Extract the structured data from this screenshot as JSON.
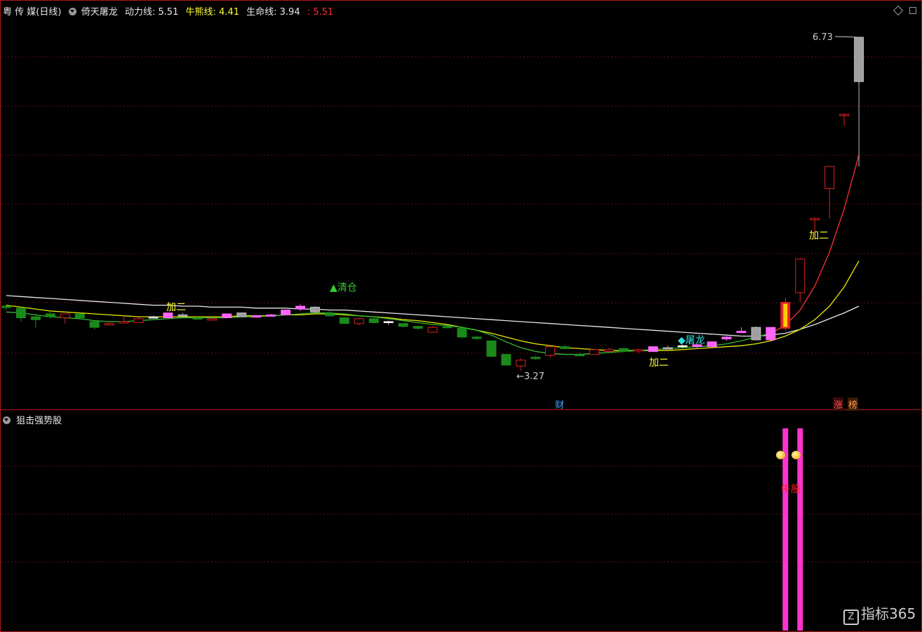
{
  "header": {
    "stock_name": "粤 传 媒(日线)",
    "indicator_name": "倚天屠龙",
    "power_label": "动力线:",
    "power_value": "5.51",
    "bull_label": "牛熊线:",
    "bull_value": "4.41",
    "life_label": "生命线:",
    "life_value": "3.94",
    "extra_value": ": 5.51"
  },
  "main_panel": {
    "price_high_label": "6.73",
    "price_low_label": "←3.27",
    "signals": [
      "清仓",
      "加二",
      "屠龙",
      "加二",
      "加二"
    ],
    "bottom_badges": [
      "财",
      "涨",
      "榜"
    ]
  },
  "sub_panel": {
    "title": "狙击强势股",
    "signal_text": "牛股"
  },
  "watermark": "指标365",
  "colors": {
    "background": "#000000",
    "border": "#b01818",
    "grid": "#5a1010",
    "up": "#e02020",
    "down": "#1a8a1a",
    "magenta": "#ff66ff",
    "gray": "#a0a0a0",
    "white_line": "#e8e8e8",
    "yellow_line": "#e8e800",
    "green_line": "#33bb33",
    "red_line": "#ff3030",
    "bar_magenta": "#ff33cc",
    "signal_yellow": "#ffff33",
    "signal_cyan": "#33dddd",
    "signal_green": "#33cc33"
  },
  "chart_data": {
    "type": "candlestick",
    "candles": [
      {
        "o": 3.94,
        "h": 3.96,
        "l": 3.9,
        "c": 3.93,
        "k": "down"
      },
      {
        "o": 3.92,
        "h": 3.93,
        "l": 3.78,
        "c": 3.82,
        "k": "down"
      },
      {
        "o": 3.83,
        "h": 3.86,
        "l": 3.72,
        "c": 3.8,
        "k": "down"
      },
      {
        "o": 3.83,
        "h": 3.88,
        "l": 3.81,
        "c": 3.86,
        "k": "down"
      },
      {
        "o": 3.82,
        "h": 3.86,
        "l": 3.76,
        "c": 3.86,
        "k": "up"
      },
      {
        "o": 3.86,
        "h": 3.87,
        "l": 3.8,
        "c": 3.82,
        "k": "down"
      },
      {
        "o": 3.78,
        "h": 3.79,
        "l": 3.7,
        "c": 3.72,
        "k": "down"
      },
      {
        "o": 3.76,
        "h": 3.77,
        "l": 3.74,
        "c": 3.76,
        "k": "up"
      },
      {
        "o": 3.77,
        "h": 3.85,
        "l": 3.76,
        "c": 3.78,
        "k": "up"
      },
      {
        "o": 3.77,
        "h": 3.82,
        "l": 3.77,
        "c": 3.81,
        "k": "up"
      },
      {
        "o": 3.83,
        "h": 3.84,
        "l": 3.82,
        "c": 3.83,
        "k": "flat"
      },
      {
        "o": 3.82,
        "h": 3.87,
        "l": 3.81,
        "c": 3.87,
        "k": "mag"
      },
      {
        "o": 3.85,
        "h": 3.87,
        "l": 3.83,
        "c": 3.85,
        "k": "gray"
      },
      {
        "o": 3.82,
        "h": 3.84,
        "l": 3.8,
        "c": 3.81,
        "k": "down"
      },
      {
        "o": 3.81,
        "h": 3.82,
        "l": 3.8,
        "c": 3.81,
        "k": "up"
      },
      {
        "o": 3.82,
        "h": 3.86,
        "l": 3.82,
        "c": 3.86,
        "k": "mag"
      },
      {
        "o": 3.83,
        "h": 3.87,
        "l": 3.83,
        "c": 3.87,
        "k": "gray"
      },
      {
        "o": 3.84,
        "h": 3.85,
        "l": 3.83,
        "c": 3.84,
        "k": "mag"
      },
      {
        "o": 3.84,
        "h": 3.86,
        "l": 3.83,
        "c": 3.85,
        "k": "mag"
      },
      {
        "o": 3.85,
        "h": 3.9,
        "l": 3.85,
        "c": 3.9,
        "k": "mag"
      },
      {
        "o": 3.91,
        "h": 3.96,
        "l": 3.89,
        "c": 3.94,
        "k": "mag"
      },
      {
        "o": 3.93,
        "h": 3.94,
        "l": 3.87,
        "c": 3.88,
        "k": "gray"
      },
      {
        "o": 3.86,
        "h": 3.89,
        "l": 3.83,
        "c": 3.84,
        "k": "down"
      },
      {
        "o": 3.82,
        "h": 3.82,
        "l": 3.76,
        "c": 3.76,
        "k": "down"
      },
      {
        "o": 3.76,
        "h": 3.82,
        "l": 3.74,
        "c": 3.81,
        "k": "up"
      },
      {
        "o": 3.81,
        "h": 3.82,
        "l": 3.76,
        "c": 3.77,
        "k": "down"
      },
      {
        "o": 3.77,
        "h": 3.79,
        "l": 3.75,
        "c": 3.78,
        "k": "cross"
      },
      {
        "o": 3.76,
        "h": 3.76,
        "l": 3.72,
        "c": 3.73,
        "k": "down"
      },
      {
        "o": 3.73,
        "h": 3.74,
        "l": 3.7,
        "c": 3.71,
        "k": "down"
      },
      {
        "o": 3.67,
        "h": 3.73,
        "l": 3.67,
        "c": 3.72,
        "k": "up"
      },
      {
        "o": 3.73,
        "h": 3.74,
        "l": 3.72,
        "c": 3.73,
        "k": "down"
      },
      {
        "o": 3.71,
        "h": 3.71,
        "l": 3.61,
        "c": 3.62,
        "k": "down"
      },
      {
        "o": 3.62,
        "h": 3.63,
        "l": 3.59,
        "c": 3.61,
        "k": "down"
      },
      {
        "o": 3.58,
        "h": 3.58,
        "l": 3.41,
        "c": 3.42,
        "k": "down"
      },
      {
        "o": 3.44,
        "h": 3.44,
        "l": 3.32,
        "c": 3.33,
        "k": "down"
      },
      {
        "o": 3.32,
        "h": 3.4,
        "l": 3.27,
        "c": 3.38,
        "k": "up"
      },
      {
        "o": 3.4,
        "h": 3.43,
        "l": 3.38,
        "c": 3.41,
        "k": "down"
      },
      {
        "o": 3.43,
        "h": 3.53,
        "l": 3.41,
        "c": 3.52,
        "k": "up"
      },
      {
        "o": 3.52,
        "h": 3.54,
        "l": 3.49,
        "c": 3.5,
        "k": "down"
      },
      {
        "o": 3.44,
        "h": 3.46,
        "l": 3.43,
        "c": 3.44,
        "k": "down"
      },
      {
        "o": 3.44,
        "h": 3.49,
        "l": 3.44,
        "c": 3.49,
        "k": "up"
      },
      {
        "o": 3.47,
        "h": 3.51,
        "l": 3.46,
        "c": 3.49,
        "k": "up"
      },
      {
        "o": 3.5,
        "h": 3.51,
        "l": 3.46,
        "c": 3.47,
        "k": "down"
      },
      {
        "o": 3.49,
        "h": 3.5,
        "l": 3.45,
        "c": 3.48,
        "k": "up"
      },
      {
        "o": 3.47,
        "h": 3.52,
        "l": 3.47,
        "c": 3.52,
        "k": "mag"
      },
      {
        "o": 3.51,
        "h": 3.53,
        "l": 3.5,
        "c": 3.51,
        "k": "gray"
      },
      {
        "o": 3.52,
        "h": 3.54,
        "l": 3.51,
        "c": 3.53,
        "k": "cross"
      },
      {
        "o": 3.52,
        "h": 3.55,
        "l": 3.51,
        "c": 3.54,
        "k": "mag"
      },
      {
        "o": 3.52,
        "h": 3.57,
        "l": 3.52,
        "c": 3.57,
        "k": "mag"
      },
      {
        "o": 3.6,
        "h": 3.63,
        "l": 3.58,
        "c": 3.62,
        "k": "mag"
      },
      {
        "o": 3.67,
        "h": 3.72,
        "l": 3.67,
        "c": 3.68,
        "k": "mag"
      },
      {
        "o": 3.59,
        "h": 3.73,
        "l": 3.59,
        "c": 3.72,
        "k": "gray"
      },
      {
        "o": 3.59,
        "h": 3.72,
        "l": 3.59,
        "c": 3.72,
        "k": "mag"
      },
      {
        "o": 3.71,
        "h": 4.03,
        "l": 3.68,
        "c": 3.98,
        "k": "ystripe"
      },
      {
        "o": 4.08,
        "h": 4.44,
        "l": 3.98,
        "c": 4.43,
        "k": "up"
      },
      {
        "o": 4.85,
        "h": 4.86,
        "l": 4.68,
        "c": 4.85,
        "k": "up"
      },
      {
        "o": 5.16,
        "h": 5.39,
        "l": 4.85,
        "c": 5.39,
        "k": "up"
      },
      {
        "o": 5.93,
        "h": 5.94,
        "l": 5.81,
        "c": 5.93,
        "k": "up"
      },
      {
        "o": 6.73,
        "h": 6.73,
        "l": 5.39,
        "c": 6.27,
        "k": "gray"
      }
    ],
    "lines": {
      "dongli": [
        3.88,
        3.87,
        3.85,
        3.83,
        3.82,
        3.81,
        3.79,
        3.78,
        3.78,
        3.79,
        3.8,
        3.81,
        3.82,
        3.82,
        3.82,
        3.82,
        3.83,
        3.83,
        3.84,
        3.85,
        3.86,
        3.87,
        3.87,
        3.86,
        3.84,
        3.83,
        3.81,
        3.79,
        3.77,
        3.75,
        3.74,
        3.72,
        3.69,
        3.64,
        3.57,
        3.51,
        3.47,
        3.45,
        3.44,
        3.44,
        3.45,
        3.46,
        3.47,
        3.48,
        3.49,
        3.5,
        3.51,
        3.52,
        3.53,
        3.55,
        3.58,
        3.62,
        3.66,
        3.74,
        3.9,
        4.15,
        4.5,
        4.95,
        5.51
      ],
      "niuxiong": [
        3.95,
        3.93,
        3.91,
        3.89,
        3.88,
        3.87,
        3.86,
        3.85,
        3.84,
        3.83,
        3.83,
        3.83,
        3.83,
        3.83,
        3.83,
        3.83,
        3.84,
        3.84,
        3.84,
        3.85,
        3.85,
        3.86,
        3.86,
        3.85,
        3.84,
        3.83,
        3.82,
        3.8,
        3.79,
        3.77,
        3.75,
        3.72,
        3.69,
        3.66,
        3.62,
        3.58,
        3.55,
        3.53,
        3.51,
        3.5,
        3.49,
        3.48,
        3.48,
        3.48,
        3.48,
        3.48,
        3.49,
        3.5,
        3.51,
        3.52,
        3.53,
        3.55,
        3.58,
        3.63,
        3.7,
        3.8,
        3.94,
        4.14,
        4.41
      ],
      "shengming": [
        4.05,
        4.04,
        4.03,
        4.02,
        4.01,
        4.0,
        3.99,
        3.98,
        3.97,
        3.96,
        3.95,
        3.95,
        3.94,
        3.94,
        3.93,
        3.93,
        3.93,
        3.92,
        3.92,
        3.92,
        3.91,
        3.91,
        3.9,
        3.9,
        3.89,
        3.88,
        3.87,
        3.86,
        3.85,
        3.84,
        3.83,
        3.82,
        3.81,
        3.8,
        3.79,
        3.78,
        3.77,
        3.76,
        3.75,
        3.74,
        3.73,
        3.72,
        3.71,
        3.7,
        3.69,
        3.68,
        3.67,
        3.66,
        3.65,
        3.64,
        3.63,
        3.63,
        3.64,
        3.66,
        3.7,
        3.75,
        3.81,
        3.87,
        3.94
      ]
    },
    "sub_bars": [
      {
        "index": 53,
        "value": 1
      },
      {
        "index": 54,
        "value": 1
      }
    ]
  }
}
